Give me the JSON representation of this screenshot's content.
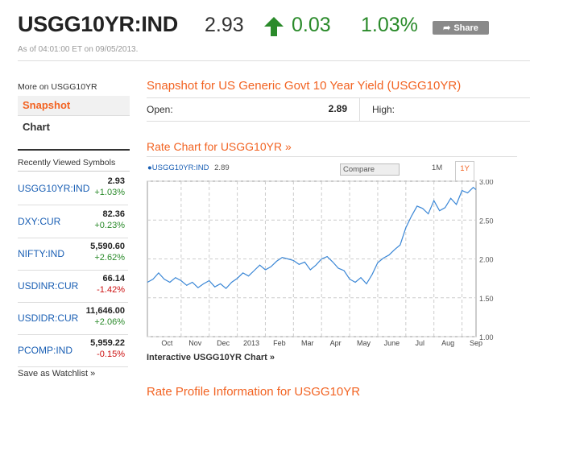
{
  "header": {
    "symbol": "USGG10YR:IND",
    "price": "2.93",
    "change": "0.03",
    "change_pct": "1.03%",
    "share_label": "Share",
    "as_of": "As of 04:01:00 ET on 09/05/2013.",
    "up_color": "#2a8a2a",
    "accent_color": "#f26322"
  },
  "sidebar": {
    "more_on": "More on USGG10YR",
    "tabs": [
      {
        "label": "Snapshot",
        "active": true
      },
      {
        "label": "Chart",
        "active": false
      }
    ],
    "recent_title": "Recently Viewed Symbols",
    "recent": [
      {
        "symbol": "USGG10YR:IND",
        "price": "2.93",
        "change": "+1.03%",
        "dir": "up"
      },
      {
        "symbol": "DXY:CUR",
        "price": "82.36",
        "change": "+0.23%",
        "dir": "up"
      },
      {
        "symbol": "NIFTY:IND",
        "price": "5,590.60",
        "change": "+2.62%",
        "dir": "up"
      },
      {
        "symbol": "USDINR:CUR",
        "price": "66.14",
        "change": "-1.42%",
        "dir": "down"
      },
      {
        "symbol": "USDIDR:CUR",
        "price": "11,646.00",
        "change": "+2.06%",
        "dir": "up"
      },
      {
        "symbol": "PCOMP:IND",
        "price": "5,959.22",
        "change": "-0.15%",
        "dir": "down"
      }
    ],
    "save_watchlist": "Save as Watchlist",
    "save_arrow": "»"
  },
  "snapshot": {
    "title": "Snapshot for US Generic Govt 10 Year Yield (USGG10YR)",
    "open_label": "Open:",
    "open_value": "2.89",
    "high_label": "High:"
  },
  "rate_chart": {
    "title": "Rate Chart for USGG10YR",
    "title_arrow": "»",
    "legend_symbol": "USGG10YR:IND",
    "legend_value": "2.89",
    "compare_label": "Compare",
    "range_1m": "1M",
    "range_1y": "1Y",
    "interactive_label": "Interactive USGG10YR Chart",
    "interactive_arrow": "»"
  },
  "profile": {
    "title": "Rate Profile Information for USGG10YR"
  },
  "chart_data": {
    "type": "line",
    "title": "",
    "xlabel": "",
    "ylabel": "",
    "x_tick_labels": [
      "Oct",
      "Nov",
      "Dec",
      "2013",
      "Feb",
      "Mar",
      "Apr",
      "May",
      "June",
      "Jul",
      "Aug",
      "Sep"
    ],
    "x_tick_positions": [
      0.5,
      1.5,
      2.5,
      3.5,
      4.5,
      5.5,
      6.5,
      7.5,
      8.5,
      9.5,
      10.5,
      11.5
    ],
    "y_ticks": [
      "1.00",
      "1.50",
      "2.00",
      "2.50",
      "3.00"
    ],
    "ylim": [
      1.0,
      3.0
    ],
    "xlim": [
      -0.2,
      11.5
    ],
    "grid": true,
    "line_color": "#3b87d6",
    "series": [
      {
        "name": "USGG10YR:IND",
        "x": [
          -0.2,
          0.0,
          0.2,
          0.4,
          0.6,
          0.8,
          1.0,
          1.2,
          1.4,
          1.6,
          1.8,
          2.0,
          2.2,
          2.4,
          2.6,
          2.8,
          3.0,
          3.2,
          3.4,
          3.6,
          3.8,
          4.0,
          4.2,
          4.4,
          4.6,
          4.8,
          5.0,
          5.2,
          5.4,
          5.6,
          5.8,
          6.0,
          6.2,
          6.4,
          6.6,
          6.8,
          7.0,
          7.2,
          7.4,
          7.6,
          7.8,
          8.0,
          8.2,
          8.4,
          8.6,
          8.8,
          9.0,
          9.2,
          9.4,
          9.6,
          9.8,
          10.0,
          10.2,
          10.4,
          10.6,
          10.8,
          11.0,
          11.2,
          11.4,
          11.5
        ],
        "y": [
          1.7,
          1.74,
          1.82,
          1.74,
          1.7,
          1.76,
          1.72,
          1.66,
          1.7,
          1.63,
          1.68,
          1.72,
          1.64,
          1.68,
          1.62,
          1.7,
          1.75,
          1.82,
          1.78,
          1.85,
          1.92,
          1.86,
          1.9,
          1.97,
          2.02,
          2.0,
          1.98,
          1.93,
          1.96,
          1.86,
          1.92,
          2.0,
          2.03,
          1.96,
          1.88,
          1.85,
          1.74,
          1.7,
          1.76,
          1.68,
          1.8,
          1.95,
          2.01,
          2.05,
          2.12,
          2.18,
          2.4,
          2.55,
          2.68,
          2.65,
          2.58,
          2.75,
          2.62,
          2.66,
          2.78,
          2.7,
          2.88,
          2.85,
          2.92,
          2.89
        ]
      }
    ]
  }
}
